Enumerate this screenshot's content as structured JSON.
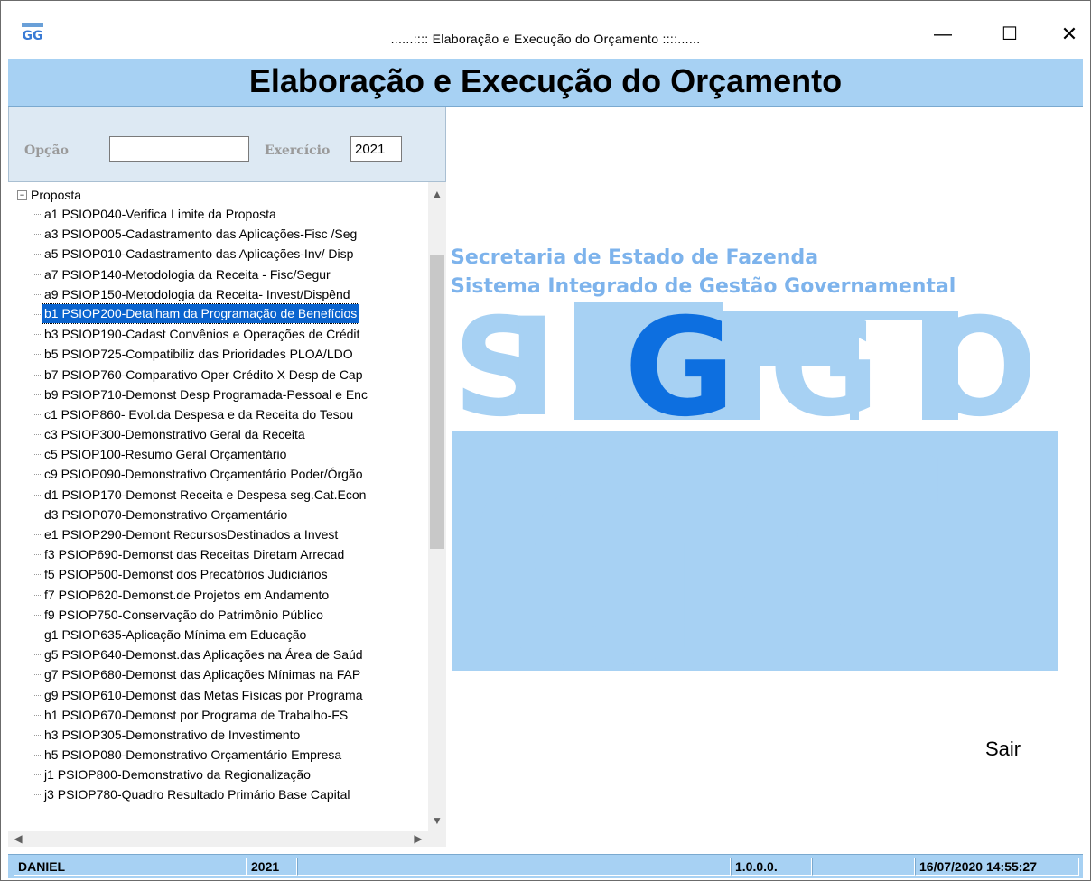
{
  "window": {
    "title": "......::::  Elaboração e Execução do Orçamento  ::::......",
    "controls": {
      "minimize": "—",
      "maximize": "☐",
      "close": "✕"
    }
  },
  "banner": {
    "title": "Elaboração e Execução do Orçamento"
  },
  "options": {
    "opcao_label": "Opção",
    "opcao_value": "",
    "exercicio_label": "Exercício",
    "exercicio_value": "2021"
  },
  "tree": {
    "root_label": "Proposta",
    "expander": "−",
    "selected_index": 5,
    "items": [
      "a1 PSIOP040-Verifica Limite da Proposta",
      "a3 PSIOP005-Cadastramento das Aplicações-Fisc /Seg",
      "a5 PSIOP010-Cadastramento das Aplicações-Inv/ Disp",
      "a7 PSIOP140-Metodologia da Receita - Fisc/Segur",
      "a9 PSIOP150-Metodologia da Receita- Invest/Dispênd",
      "b1 PSIOP200-Detalham da Programação de Benefícios",
      "b3 PSIOP190-Cadast Convênios e Operações de Crédit",
      "b5 PSIOP725-Compatibiliz das Prioridades PLOA/LDO",
      "b7 PSIOP760-Comparativo Oper Crédito X Desp de Cap",
      "b9 PSIOP710-Demonst Desp Programada-Pessoal e Enc",
      "c1 PSIOP860- Evol.da Despesa e da Receita do Tesou",
      "c3 PSIOP300-Demonstrativo Geral da Receita",
      "c5 PSIOP100-Resumo Geral Orçamentário",
      "c9 PSIOP090-Demonstrativo Orçamentário Poder/Órgão",
      "d1 PSIOP170-Demonst Receita e Despesa seg.Cat.Econ",
      "d3 PSIOP070-Demonstrativo Orçamentário",
      "e1 PSIOP290-Demont RecursosDestinados a Invest",
      "f3 PSIOP690-Demonst das Receitas Diretam Arrecad",
      "f5 PSIOP500-Demonst dos Precatórios Judiciários",
      "f7 PSIOP620-Demonst.de Projetos em Andamento",
      "f9 PSIOP750-Conservação do Patrimônio Público",
      "g1 PSIOP635-Aplicação Mínima em Educação",
      "g5 PSIOP640-Demonst.das Aplicações na Área de Saúd",
      "g7 PSIOP680-Demonst das Aplicações Mínimas na FAP",
      "g9 PSIOP610-Demonst das Metas Físicas por Programa",
      "h1 PSIOP670-Demonst por Programa de Trabalho-FS",
      "h3 PSIOP305-Demonstrativo de Investimento",
      "h5 PSIOP080-Demonstrativo Orçamentário Empresa",
      "j1 PSIOP800-Demonstrativo da Regionalização",
      "j3 PSIOP780-Quadro Resultado Primário Base Capital"
    ]
  },
  "logo": {
    "line1": "Secretaria de Estado de Fazenda",
    "line2": "Sistema Integrado de Gestão Governamental",
    "brand": "SIGGO",
    "app_icon_text": "GG"
  },
  "actions": {
    "sair": "Sair"
  },
  "status": {
    "user": "DANIEL",
    "year": "2021",
    "version": "1.0.0.0.",
    "datetime": "16/07/2020 14:55:27"
  },
  "colors": {
    "banner": "#a7d1f3",
    "logo_light": "#a7d1f3",
    "logo_dark": "#0d6fe0",
    "selection": "#0a64cf"
  }
}
